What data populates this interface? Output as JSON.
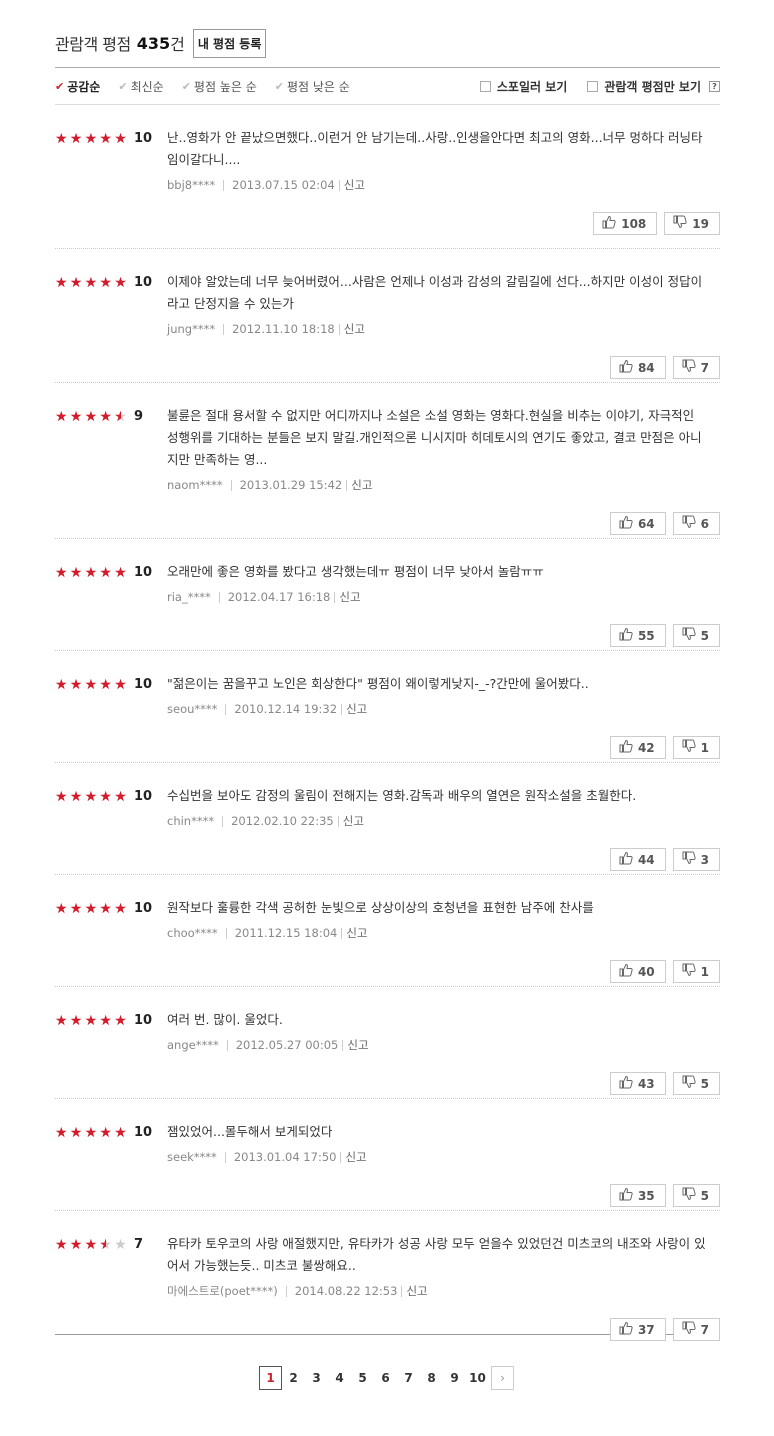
{
  "header": {
    "title": "관람객 평점",
    "count": "435",
    "unit": "건",
    "register_button": "내 평점 등록"
  },
  "sort": {
    "items": [
      {
        "label": "공감순",
        "active": true
      },
      {
        "label": "최신순",
        "active": false
      },
      {
        "label": "평점 높은 순",
        "active": false
      },
      {
        "label": "평점 낮은 순",
        "active": false
      }
    ],
    "spoiler_label": "스포일러 보기",
    "audience_only_label": "관람객 평점만 보기",
    "help_icon": "?"
  },
  "reviews": [
    {
      "rating": 10,
      "score": "10",
      "text": "난..영화가 안 끝났으면했다..이런거 안 남기는데..사랑..인생을안다면 최고의 영화...너무 멍하다 러닝타임이갈다니....",
      "user": "bbj8****",
      "date": "2013.07.15 02:04",
      "report": "신고",
      "likes": "108",
      "dislikes": "19"
    },
    {
      "rating": 10,
      "score": "10",
      "text": "이제야 알았는데 너무 늦어버렸어...사람은 언제나 이성과 감성의 갈림길에 선다...하지만 이성이 정답이라고 단정지을 수 있는가",
      "user": "jung****",
      "date": "2012.11.10 18:18",
      "report": "신고",
      "likes": "84",
      "dislikes": "7"
    },
    {
      "rating": 9,
      "score": "9",
      "text": "불륜은 절대 용서할 수 없지만 어디까지나 소설은 소설 영화는 영화다.현실을 비추는 이야기, 자극적인 성행위를 기대하는 분들은 보지 말길.개인적으론 니시지마 히데토시의 연기도 좋았고, 결코 만점은 아니지만 만족하는 영...",
      "user": "naom****",
      "date": "2013.01.29 15:42",
      "report": "신고",
      "likes": "64",
      "dislikes": "6"
    },
    {
      "rating": 10,
      "score": "10",
      "text": "오래만에 좋은 영화를 봤다고 생각했는데ㅠ 평점이 너무 낮아서 놀람ㅠㅠ",
      "user": "ria_****",
      "date": "2012.04.17 16:18",
      "report": "신고",
      "likes": "55",
      "dislikes": "5"
    },
    {
      "rating": 10,
      "score": "10",
      "text": "\"젊은이는 꿈을꾸고 노인은 회상한다\" 평점이 왜이렇게낮지-_-?간만에 울어봤다..",
      "user": "seou****",
      "date": "2010.12.14 19:32",
      "report": "신고",
      "likes": "42",
      "dislikes": "1"
    },
    {
      "rating": 10,
      "score": "10",
      "text": "수십번을 보아도 감정의 울림이 전해지는 영화.감독과 배우의 열연은 원작소설을 초월한다.",
      "user": "chin****",
      "date": "2012.02.10 22:35",
      "report": "신고",
      "likes": "44",
      "dislikes": "3"
    },
    {
      "rating": 10,
      "score": "10",
      "text": "원작보다 훌륭한 각색 공허한 눈빛으로 상상이상의 호청년을 표현한 남주에 찬사를",
      "user": "choo****",
      "date": "2011.12.15 18:04",
      "report": "신고",
      "likes": "40",
      "dislikes": "1"
    },
    {
      "rating": 10,
      "score": "10",
      "text": "여러 번. 많이. 울었다.",
      "user": "ange****",
      "date": "2012.05.27 00:05",
      "report": "신고",
      "likes": "43",
      "dislikes": "5"
    },
    {
      "rating": 10,
      "score": "10",
      "text": "잼있었어...몰두해서 보게되었다",
      "user": "seek****",
      "date": "2013.01.04 17:50",
      "report": "신고",
      "likes": "35",
      "dislikes": "5"
    },
    {
      "rating": 7,
      "score": "7",
      "text": "유타카 토우코의 사랑 애절했지만, 유타카가 성공 사랑 모두 얻을수 있었던건 미츠코의 내조와 사랑이 있어서 가능했는듯.. 미츠코 불쌍해요..",
      "user": "마에스트로(poet****)",
      "date": "2014.08.22 12:53",
      "report": "신고",
      "likes": "37",
      "dislikes": "7"
    }
  ],
  "pagination": {
    "pages": [
      "1",
      "2",
      "3",
      "4",
      "5",
      "6",
      "7",
      "8",
      "9",
      "10"
    ],
    "current": "1",
    "next_icon": "chevron-right-icon"
  },
  "colors": {
    "star": "#d71a2b",
    "accent": "#d21d2f"
  }
}
